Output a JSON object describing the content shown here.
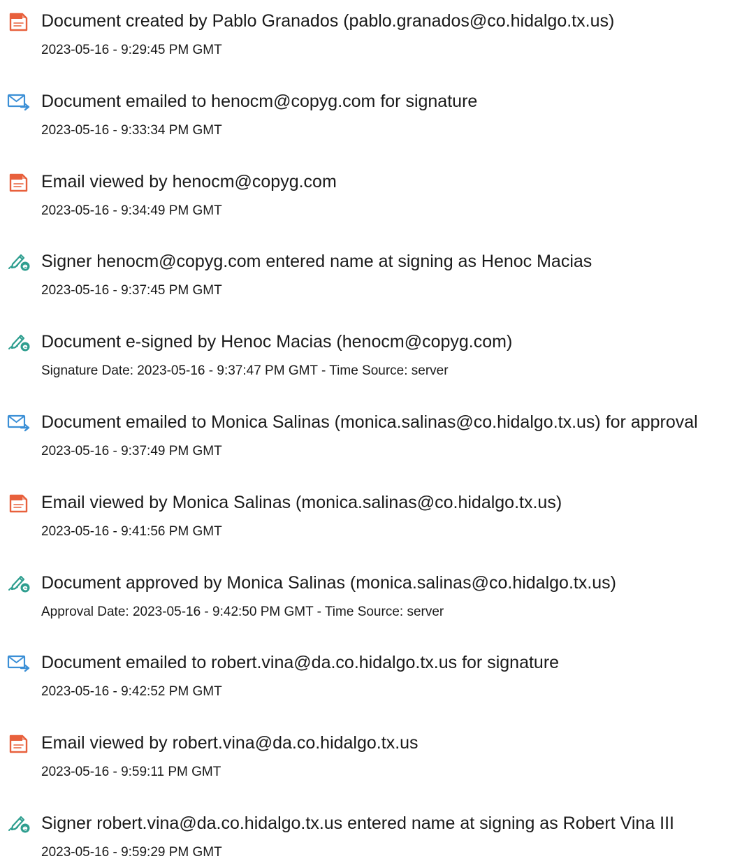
{
  "colors": {
    "document_icon": "#e8603c",
    "email_icon": "#3b8fd6",
    "signature_icon": "#2e9e8f",
    "text": "#1a1a1a"
  },
  "events": [
    {
      "icon": "document-icon",
      "title": "Document created by Pablo Granados (pablo.granados@co.hidalgo.tx.us)",
      "detail": "2023-05-16 - 9:29:45 PM GMT"
    },
    {
      "icon": "email-sent-icon",
      "title": "Document emailed to henocm@copyg.com for signature",
      "detail": "2023-05-16 - 9:33:34 PM GMT"
    },
    {
      "icon": "document-icon",
      "title": "Email viewed by henocm@copyg.com",
      "detail": "2023-05-16 - 9:34:49 PM GMT"
    },
    {
      "icon": "signature-pen-icon",
      "title": "Signer henocm@copyg.com entered name at signing as Henoc Macias",
      "detail": "2023-05-16 - 9:37:45 PM GMT"
    },
    {
      "icon": "signature-pen-icon",
      "title": "Document e-signed by Henoc Macias (henocm@copyg.com)",
      "detail": "Signature Date: 2023-05-16 - 9:37:47 PM GMT - Time Source: server"
    },
    {
      "icon": "email-sent-icon",
      "title": "Document emailed to Monica Salinas (monica.salinas@co.hidalgo.tx.us) for approval",
      "detail": "2023-05-16 - 9:37:49 PM GMT"
    },
    {
      "icon": "document-icon",
      "title": "Email viewed by Monica Salinas (monica.salinas@co.hidalgo.tx.us)",
      "detail": "2023-05-16 - 9:41:56 PM GMT"
    },
    {
      "icon": "signature-pen-icon",
      "title": "Document approved by Monica Salinas (monica.salinas@co.hidalgo.tx.us)",
      "detail": "Approval Date: 2023-05-16 - 9:42:50 PM GMT - Time Source: server"
    },
    {
      "icon": "email-sent-icon",
      "title": "Document emailed to robert.vina@da.co.hidalgo.tx.us for signature",
      "detail": "2023-05-16 - 9:42:52 PM GMT"
    },
    {
      "icon": "document-icon",
      "title": "Email viewed by robert.vina@da.co.hidalgo.tx.us",
      "detail": "2023-05-16 - 9:59:11 PM GMT"
    },
    {
      "icon": "signature-pen-icon",
      "title": "Signer robert.vina@da.co.hidalgo.tx.us entered name at signing as Robert Vina III",
      "detail": "2023-05-16 - 9:59:29 PM GMT"
    }
  ]
}
